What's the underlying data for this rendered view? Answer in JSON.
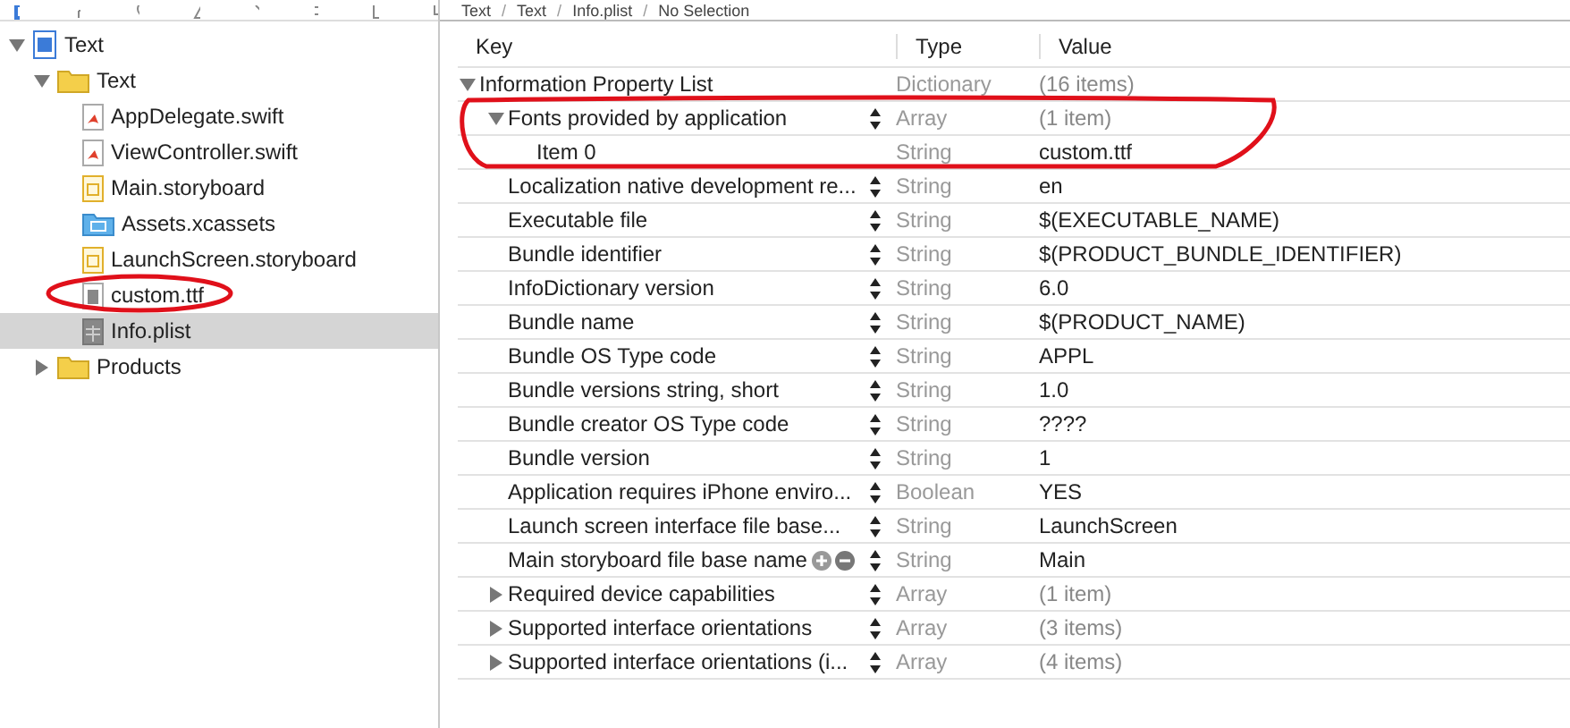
{
  "breadcrumb": [
    {
      "label": "Text",
      "separator": "/"
    },
    {
      "label": "Text",
      "separator": "/"
    },
    {
      "label": "Info.plist",
      "separator": "/"
    },
    {
      "label": "No Selection"
    }
  ],
  "navigator": {
    "items": [
      {
        "label": "Text",
        "kind": "project",
        "expanded": true,
        "selected": false,
        "children": [
          {
            "label": "Text",
            "kind": "folder",
            "expanded": true,
            "selected": false,
            "children": [
              {
                "label": "AppDelegate.swift",
                "kind": "swift",
                "selected": false
              },
              {
                "label": "ViewController.swift",
                "kind": "swift",
                "selected": false
              },
              {
                "label": "Main.storyboard",
                "kind": "storyboard",
                "selected": false
              },
              {
                "label": "Assets.xcassets",
                "kind": "assets",
                "selected": false
              },
              {
                "label": "LaunchScreen.storyboard",
                "kind": "storyboard",
                "selected": false
              },
              {
                "label": "custom.ttf",
                "kind": "file",
                "selected": false
              },
              {
                "label": "Info.plist",
                "kind": "plist",
                "selected": true
              }
            ]
          },
          {
            "label": "Products",
            "kind": "folder",
            "expanded": false,
            "selected": false
          }
        ]
      }
    ]
  },
  "plist": {
    "columns": [
      "Key",
      "Type",
      "Value"
    ],
    "rows": [
      {
        "key": "Information Property List",
        "type": "Dictionary",
        "value": "(16 items)",
        "expanded": true,
        "stepper": false,
        "hovered": false,
        "children": [
          {
            "key": "Fonts provided by application",
            "type": "Array",
            "value": "(1 item)",
            "expanded": true,
            "stepper": true,
            "hovered": false,
            "children": [
              {
                "key": "Item 0",
                "type": "String",
                "value": "custom.ttf",
                "stepper": false,
                "hovered": false
              }
            ]
          },
          {
            "key": "Localization native development re...",
            "type": "String",
            "value": "en",
            "stepper": true,
            "hovered": false
          },
          {
            "key": "Executable file",
            "type": "String",
            "value": "$(EXECUTABLE_NAME)",
            "stepper": true,
            "hovered": false
          },
          {
            "key": "Bundle identifier",
            "type": "String",
            "value": "$(PRODUCT_BUNDLE_IDENTIFIER)",
            "stepper": true,
            "hovered": false
          },
          {
            "key": "InfoDictionary version",
            "type": "String",
            "value": "6.0",
            "stepper": true,
            "hovered": false
          },
          {
            "key": "Bundle name",
            "type": "String",
            "value": "$(PRODUCT_NAME)",
            "stepper": true,
            "hovered": false
          },
          {
            "key": "Bundle OS Type code",
            "type": "String",
            "value": "APPL",
            "stepper": true,
            "hovered": false
          },
          {
            "key": "Bundle versions string, short",
            "type": "String",
            "value": "1.0",
            "stepper": true,
            "hovered": false
          },
          {
            "key": "Bundle creator OS Type code",
            "type": "String",
            "value": "????",
            "stepper": true,
            "hovered": false
          },
          {
            "key": "Bundle version",
            "type": "String",
            "value": "1",
            "stepper": true,
            "hovered": false
          },
          {
            "key": "Application requires iPhone enviro...",
            "type": "Boolean",
            "value": "YES",
            "stepper": true,
            "hovered": false
          },
          {
            "key": "Launch screen interface file base...",
            "type": "String",
            "value": "LaunchScreen",
            "stepper": true,
            "hovered": false
          },
          {
            "key": "Main storyboard file base name",
            "type": "String",
            "value": "Main",
            "stepper": true,
            "hovered": true
          },
          {
            "key": "Required device capabilities",
            "type": "Array",
            "value": "(1 item)",
            "expanded": false,
            "stepper": true,
            "hovered": false
          },
          {
            "key": "Supported interface orientations",
            "type": "Array",
            "value": "(3 items)",
            "expanded": false,
            "stepper": true,
            "hovered": false
          },
          {
            "key": "Supported interface orientations (i...",
            "type": "Array",
            "value": "(4 items)",
            "expanded": false,
            "stepper": true,
            "hovered": false
          }
        ]
      }
    ]
  }
}
